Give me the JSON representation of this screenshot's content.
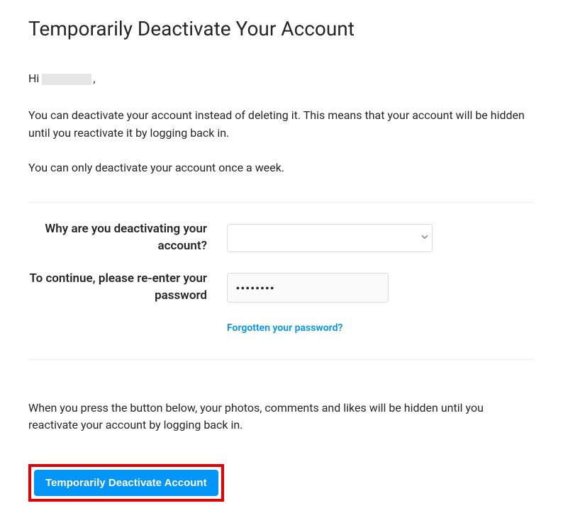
{
  "title": "Temporarily Deactivate Your Account",
  "greeting_prefix": "Hi",
  "greeting_suffix": ",",
  "description1": "You can deactivate your account instead of deleting it. This means that your account will be hidden until you reactivate it by logging back in.",
  "description2": "You can only deactivate your account once a week.",
  "form": {
    "reason_label": "Why are you deactivating your account?",
    "reason_value": "",
    "password_label": "To continue, please re-enter your password",
    "password_value": "••••••••",
    "forgot_link": "Forgotten your password?"
  },
  "bottom_info": "When you press the button below, your photos, comments and likes will be hidden until you reactivate your account by logging back in.",
  "button_label": "Temporarily Deactivate Account"
}
